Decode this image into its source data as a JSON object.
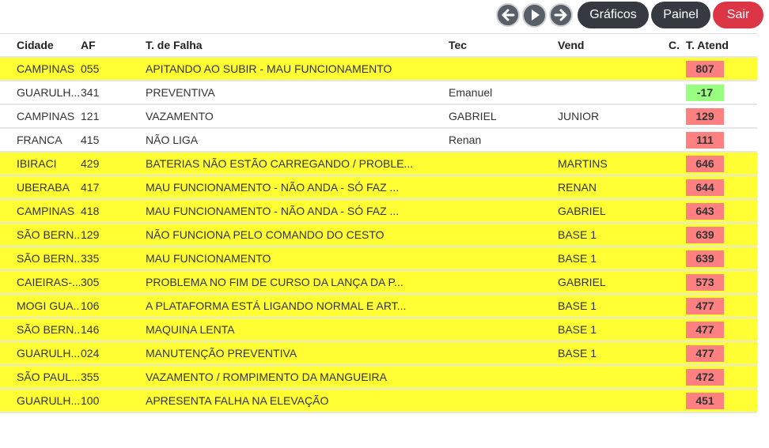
{
  "toolbar": {
    "prev_icon": "arrow-left-icon",
    "play_icon": "play-icon",
    "next_icon": "arrow-right-icon",
    "graficos_label": "Gráficos",
    "painel_label": "Painel",
    "sair_label": "Sair",
    "dark_color": "#343a40",
    "red_color": "#dc3545"
  },
  "table": {
    "headers": {
      "cidade": "Cidade",
      "af": "AF",
      "falha": "T. de Falha",
      "tec": "Tec",
      "vend": "Vend",
      "c": "C.",
      "atend": "T. Atend"
    },
    "colors": {
      "highlight_row": "#ffff33",
      "badge_red": "#ff8080",
      "badge_green": "#99ff80"
    },
    "rows": [
      {
        "cidade": "CAMPINAS",
        "af": "055",
        "falha": "APITANDO AO SUBIR - MAU FUNCIONAMENTO",
        "tec": "",
        "vend": "",
        "c": "",
        "atend": "807",
        "highlight": true,
        "badge": "red"
      },
      {
        "cidade": "GUARULH...",
        "af": "341",
        "falha": "PREVENTIVA",
        "tec": "Emanuel",
        "vend": "",
        "c": "",
        "atend": "-17",
        "highlight": false,
        "badge": "green"
      },
      {
        "cidade": "CAMPINAS",
        "af": "121",
        "falha": "VAZAMENTO",
        "tec": "GABRIEL",
        "vend": "JUNIOR",
        "c": "",
        "atend": "129",
        "highlight": false,
        "badge": "red"
      },
      {
        "cidade": "FRANCA",
        "af": "415",
        "falha": "NÃO LIGA",
        "tec": "Renan",
        "vend": "",
        "c": "",
        "atend": "111",
        "highlight": false,
        "badge": "red"
      },
      {
        "cidade": "IBIRACI",
        "af": "429",
        "falha": "BATERIAS NÃO ESTÃO CARREGANDO / PROBLE...",
        "tec": "",
        "vend": "MARTINS",
        "c": "",
        "atend": "646",
        "highlight": true,
        "badge": "red"
      },
      {
        "cidade": "UBERABA",
        "af": "417",
        "falha": "MAU FUNCIONAMENTO - NÃO ANDA - SÓ FAZ ...",
        "tec": "",
        "vend": "RENAN",
        "c": "",
        "atend": "644",
        "highlight": true,
        "badge": "red"
      },
      {
        "cidade": "CAMPINAS",
        "af": "418",
        "falha": "MAU FUNCIONAMENTO - NÃO ANDA - SÓ FAZ ...",
        "tec": "",
        "vend": "GABRIEL",
        "c": "",
        "atend": "643",
        "highlight": true,
        "badge": "red"
      },
      {
        "cidade": "SÃO BERN...",
        "af": "129",
        "falha": "NÃO FUNCIONA PELO COMANDO DO CESTO",
        "tec": "",
        "vend": "BASE 1",
        "c": "",
        "atend": "639",
        "highlight": true,
        "badge": "red"
      },
      {
        "cidade": "SÃO BERN...",
        "af": "335",
        "falha": "MAU FUNCIONAMENTO",
        "tec": "",
        "vend": "BASE 1",
        "c": "",
        "atend": "639",
        "highlight": true,
        "badge": "red"
      },
      {
        "cidade": "CAIEIRAS-...",
        "af": "305",
        "falha": "PROBLEMA NO FIM DE CURSO DA LANÇA DA P...",
        "tec": "",
        "vend": "GABRIEL",
        "c": "",
        "atend": "573",
        "highlight": true,
        "badge": "red"
      },
      {
        "cidade": "MOGI GUA...",
        "af": "106",
        "falha": "A PLATAFORMA ESTÁ LIGANDO NORMAL E ART...",
        "tec": "",
        "vend": "BASE 1",
        "c": "",
        "atend": "477",
        "highlight": true,
        "badge": "red"
      },
      {
        "cidade": "SÃO BERN...",
        "af": "146",
        "falha": "MAQUINA LENTA",
        "tec": "",
        "vend": "BASE 1",
        "c": "",
        "atend": "477",
        "highlight": true,
        "badge": "red"
      },
      {
        "cidade": "GUARULH...",
        "af": "024",
        "falha": "MANUTENÇÃO PREVENTIVA",
        "tec": "",
        "vend": "BASE 1",
        "c": "",
        "atend": "477",
        "highlight": true,
        "badge": "red"
      },
      {
        "cidade": "SÃO PAUL...",
        "af": "355",
        "falha": "VAZAMENTO / ROMPIMENTO DA MANGUEIRA",
        "tec": "",
        "vend": "",
        "c": "",
        "atend": "472",
        "highlight": true,
        "badge": "red"
      },
      {
        "cidade": "GUARULH...",
        "af": "100",
        "falha": "APRESENTA FALHA NA ELEVAÇÃO",
        "tec": "",
        "vend": "",
        "c": "",
        "atend": "451",
        "highlight": true,
        "badge": "red"
      }
    ]
  }
}
